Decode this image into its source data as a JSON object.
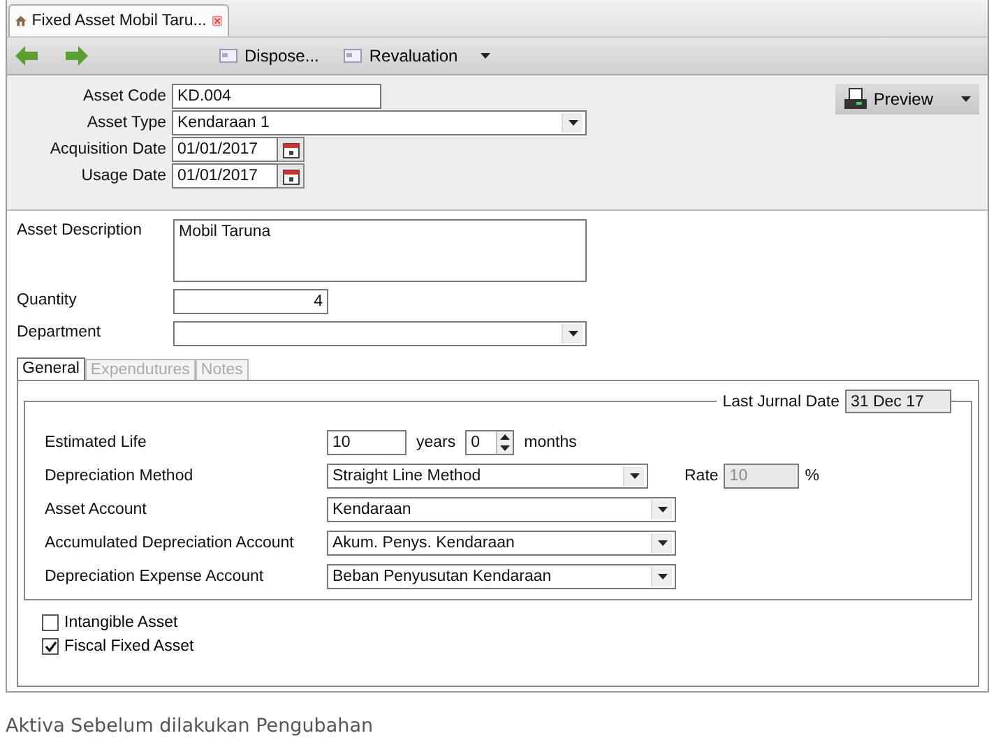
{
  "doc_tab": {
    "title": "Fixed Asset Mobil Taru...",
    "selected": true
  },
  "toolbar": {
    "buttons": [
      {
        "label": "Dispose...",
        "dropdown": false
      },
      {
        "label": "Revaluation",
        "dropdown": true
      }
    ]
  },
  "preview_button": {
    "label": "Preview"
  },
  "header_fields": [
    {
      "kind": "text",
      "label": "Asset Code",
      "value": "KD.004"
    },
    {
      "kind": "select",
      "label": "Asset Type",
      "value": "Kendaraan 1"
    },
    {
      "kind": "date",
      "label": "Acquisition Date",
      "value": "01/01/2017"
    },
    {
      "kind": "date",
      "label": "Usage Date",
      "value": "01/01/2017"
    }
  ],
  "body_fields": [
    {
      "kind": "textarea",
      "label": "Asset Description",
      "value": "Mobil Taruna"
    },
    {
      "kind": "number",
      "label": "Quantity",
      "value": "4"
    },
    {
      "kind": "select",
      "label": "Department"
    }
  ],
  "tabs": [
    {
      "label": "General",
      "selected": true,
      "disabled": false
    },
    {
      "label": "Expendutures",
      "selected": false,
      "disabled": true
    },
    {
      "label": "Notes",
      "selected": false,
      "disabled": true
    }
  ],
  "last_jurnal_date": {
    "label": "Last Jurnal Date",
    "value": "31 Dec 17"
  },
  "general_rows": [
    {
      "kind": "duration",
      "label": "Estimated Life",
      "years": "10",
      "years_unit": "years",
      "months": "0",
      "months_unit": "months"
    },
    {
      "kind": "select",
      "label": "Depreciation Method",
      "value": "Straight Line Method",
      "rate": {
        "label": "Rate",
        "value": "10",
        "unit": "%",
        "disabled": true
      }
    },
    {
      "kind": "select",
      "label": "Asset Account",
      "value": "Kendaraan"
    },
    {
      "kind": "select",
      "label": "Accumulated Depreciation Account",
      "value": "Akum. Penys. Kendaraan"
    },
    {
      "kind": "select",
      "label": "Depreciation Expense Account",
      "value": "Beban Penyusutan Kendaraan"
    }
  ],
  "checkboxes": [
    {
      "label": "Intangible Asset",
      "checked": false
    },
    {
      "label": "Fiscal Fixed Asset",
      "checked": true
    }
  ],
  "caption": "Aktiva Sebelum dilakukan Pengubahan"
}
